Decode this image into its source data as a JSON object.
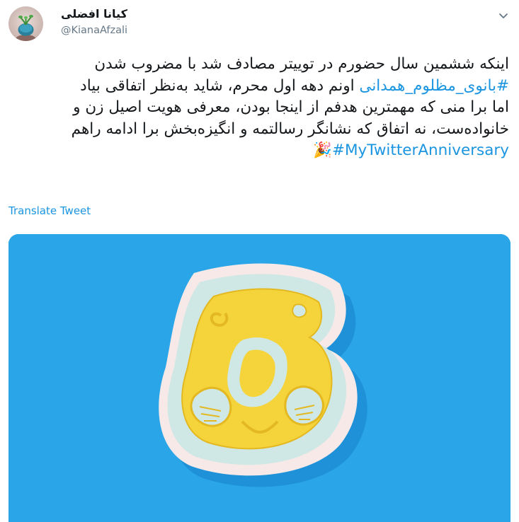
{
  "author": {
    "display_name": "کیانا افضلی",
    "handle": "@KianaAfzali"
  },
  "tweet": {
    "line1": "اینکه ششمین سال حضورم در توییتر مصادف شد با مضروب شدن",
    "line2_hashtag": "#بانوی_مظلوم_همدانی",
    "line2_text": " اونم دهه اول محرم، شاید به‌نظر اتفاقی بیاد",
    "line3": "اما برا منی که مهمترین هدفم از اینجا بودن، معرفی هویت اصیل زن و",
    "line4": "خانواده‌ست، نه اتفاق که نشانگر رسالتمه و انگیزه‌بخش برا ادامه راهم",
    "line5_hashtag": "#MyTwitterAnniversary",
    "line5_emoji": "🎉"
  },
  "translate_label": "Translate Tweet",
  "media": {
    "alt": "Paper-cut number 6"
  },
  "colors": {
    "link": "#1b95e0",
    "media_bg": "#2aa6e8",
    "paper_yellow": "#f4d43a",
    "paper_mint": "#cfe8e6"
  },
  "icons": {
    "caret": "chevron-down-icon"
  }
}
